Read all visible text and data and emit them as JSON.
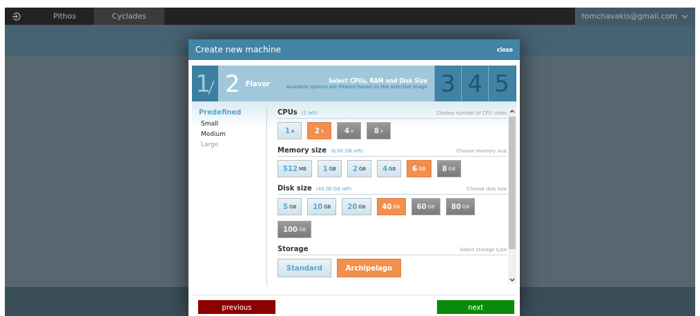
{
  "top_bar": {
    "tabs": [
      {
        "label": "Pithos",
        "selected": false
      },
      {
        "label": "Cyclades",
        "selected": true
      }
    ],
    "user": "tomchavakis@gmail.com"
  },
  "dialog": {
    "title": "Create new machine",
    "close": "close",
    "steps": [
      {
        "number": "1",
        "kind": "done"
      },
      {
        "number": "2",
        "kind": "current",
        "name": "Flavor",
        "heading": "Select CPUs, RAM and Disk Size",
        "subheading": "Available options are filtered based on the selected image"
      },
      {
        "number": "3",
        "kind": "pending"
      },
      {
        "number": "4",
        "kind": "pending"
      },
      {
        "number": "5",
        "kind": "pending"
      }
    ],
    "predefined": {
      "title": "Predefined",
      "items": [
        {
          "label": "Small",
          "disabled": false
        },
        {
          "label": "Medium",
          "disabled": false
        },
        {
          "label": "Large",
          "disabled": true
        }
      ]
    },
    "sections": [
      {
        "title": "CPUs",
        "note": "(2 left)",
        "hint": "Choose number of CPU cores",
        "options": [
          {
            "value": "1",
            "unit": "x",
            "selected": false,
            "disabled": false
          },
          {
            "value": "2",
            "unit": "x",
            "selected": true,
            "disabled": false
          },
          {
            "value": "4",
            "unit": "x",
            "selected": false,
            "disabled": true
          },
          {
            "value": "8",
            "unit": "x",
            "selected": false,
            "disabled": true
          }
        ]
      },
      {
        "title": "Memory size",
        "note": "(6.00 GB left)",
        "hint": "Choose memory size",
        "options": [
          {
            "value": "512",
            "unit": "MB",
            "selected": false,
            "disabled": false
          },
          {
            "value": "1",
            "unit": "GB",
            "selected": false,
            "disabled": false
          },
          {
            "value": "2",
            "unit": "GB",
            "selected": false,
            "disabled": false
          },
          {
            "value": "4",
            "unit": "GB",
            "selected": false,
            "disabled": false
          },
          {
            "value": "6",
            "unit": "GB",
            "selected": true,
            "disabled": false
          },
          {
            "value": "8",
            "unit": "GB",
            "selected": false,
            "disabled": true
          }
        ]
      },
      {
        "title": "Disk size",
        "note": "(40.00 GB left)",
        "hint": "Choose disk size",
        "options": [
          {
            "value": "5",
            "unit": "GB",
            "selected": false,
            "disabled": false
          },
          {
            "value": "10",
            "unit": "GB",
            "selected": false,
            "disabled": false
          },
          {
            "value": "20",
            "unit": "GB",
            "selected": false,
            "disabled": false
          },
          {
            "value": "40",
            "unit": "GB",
            "selected": true,
            "disabled": false
          },
          {
            "value": "60",
            "unit": "GB",
            "selected": false,
            "disabled": true
          },
          {
            "value": "80",
            "unit": "GB",
            "selected": false,
            "disabled": true
          },
          {
            "value": "100",
            "unit": "GB",
            "selected": false,
            "disabled": true
          }
        ]
      },
      {
        "title": "Storage",
        "hint": "Select storage type",
        "options": [
          {
            "value": "Standard",
            "selected": false,
            "disabled": false
          },
          {
            "value": "Archipelago",
            "selected": true,
            "disabled": false
          }
        ]
      }
    ],
    "buttons": {
      "previous": "previous",
      "next": "next"
    }
  }
}
